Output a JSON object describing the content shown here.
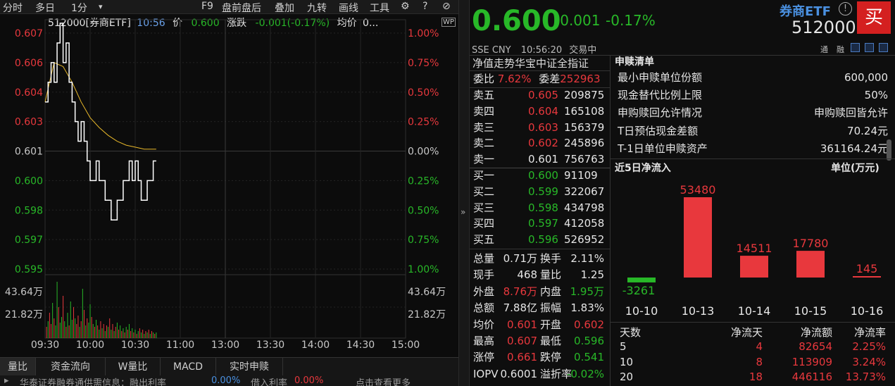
{
  "toolbar": {
    "items": [
      "分时",
      "多日",
      "1分",
      "F9",
      "盘前盘后",
      "叠加",
      "九转",
      "画线",
      "工具"
    ],
    "dropdown_glyph": "▾",
    "gear": "⚙",
    "help": "?",
    "close": "⊘"
  },
  "chart_header": {
    "code_name": "512000[券商ETF]",
    "time": "10:56",
    "price_label": "价",
    "price": "0.600",
    "change_label": "涨跌",
    "change": "-0.001(-0.17%)",
    "avg_label": "均价",
    "avg": "0...",
    "wp": "WP"
  },
  "price_axis_left": [
    "0.607",
    "0.606",
    "0.604",
    "0.603",
    "0.601",
    "0.600",
    "0.598",
    "0.597",
    "0.595"
  ],
  "price_axis_right": [
    "1.00%",
    "0.75%",
    "0.50%",
    "0.25%",
    "0.00%",
    "0.25%",
    "0.50%",
    "0.75%",
    "1.00%"
  ],
  "volume_axis": [
    "43.64万",
    "21.82万"
  ],
  "time_axis": [
    "09:30",
    "10:00",
    "10:30",
    "11:00",
    "13:00",
    "13:30",
    "14:00",
    "14:30",
    "15:00"
  ],
  "chart_data": {
    "type": "line",
    "x_unit": "minutes since 09:30",
    "price_series": [
      [
        0,
        0.6035
      ],
      [
        2,
        0.6045
      ],
      [
        4,
        0.6055
      ],
      [
        6,
        0.6045
      ],
      [
        8,
        0.6065
      ],
      [
        10,
        0.6075
      ],
      [
        12,
        0.6055
      ],
      [
        14,
        0.6065
      ],
      [
        16,
        0.6045
      ],
      [
        18,
        0.6035
      ],
      [
        20,
        0.6025
      ],
      [
        22,
        0.6015
      ],
      [
        24,
        0.6025
      ],
      [
        26,
        0.6015
      ],
      [
        28,
        0.6005
      ],
      [
        30,
        0.5995
      ],
      [
        32,
        0.5995
      ],
      [
        34,
        0.6005
      ],
      [
        36,
        0.5995
      ],
      [
        38,
        0.5995
      ],
      [
        40,
        0.5985
      ],
      [
        42,
        0.5985
      ],
      [
        44,
        0.5975
      ],
      [
        46,
        0.5975
      ],
      [
        48,
        0.5985
      ],
      [
        50,
        0.5985
      ],
      [
        52,
        0.5995
      ],
      [
        54,
        0.5995
      ],
      [
        56,
        0.6005
      ],
      [
        58,
        0.5995
      ],
      [
        60,
        0.6005
      ],
      [
        62,
        0.5995
      ],
      [
        64,
        0.5985
      ],
      [
        66,
        0.5985
      ],
      [
        68,
        0.5995
      ],
      [
        70,
        0.5995
      ],
      [
        72,
        0.6005
      ],
      [
        74,
        0.6005
      ]
    ],
    "avg_series": [
      [
        0,
        0.6035
      ],
      [
        6,
        0.6055
      ],
      [
        12,
        0.6053
      ],
      [
        18,
        0.6045
      ],
      [
        24,
        0.6035
      ],
      [
        30,
        0.6027
      ],
      [
        36,
        0.6022
      ],
      [
        42,
        0.6018
      ],
      [
        48,
        0.6015
      ],
      [
        54,
        0.6013
      ],
      [
        60,
        0.6012
      ],
      [
        66,
        0.6011
      ],
      [
        72,
        0.6011
      ],
      [
        74,
        0.6011
      ]
    ],
    "volume_series": [
      8,
      12,
      18,
      10,
      25,
      14,
      9,
      40,
      22,
      11,
      15,
      30,
      12,
      8,
      18,
      9,
      26,
      13,
      22,
      14,
      10,
      16,
      8,
      12,
      35,
      20,
      9,
      14,
      11,
      24,
      15,
      10,
      8,
      13,
      9,
      6,
      12,
      7,
      10,
      5,
      9,
      8,
      14,
      6,
      10,
      5,
      8,
      11,
      6,
      9,
      5,
      7,
      4,
      8,
      6,
      10,
      5,
      7,
      4,
      6,
      3,
      5,
      7,
      4,
      6,
      3,
      5,
      4,
      6,
      3,
      5,
      4,
      3,
      4
    ],
    "volume_colors": [
      "r",
      "g",
      "r",
      "r",
      "g",
      "r",
      "g",
      "g",
      "r",
      "g",
      "g",
      "r",
      "g",
      "r",
      "g",
      "r",
      "g",
      "g",
      "r",
      "g",
      "r",
      "r",
      "g",
      "r",
      "g",
      "r",
      "g",
      "r",
      "g",
      "g",
      "r",
      "g",
      "r",
      "g",
      "r",
      "g",
      "r",
      "g",
      "r",
      "g",
      "r",
      "g",
      "r",
      "g",
      "r",
      "g",
      "r",
      "g",
      "r",
      "g",
      "r",
      "g",
      "r",
      "g",
      "r",
      "g",
      "r",
      "g",
      "r",
      "g",
      "r",
      "g",
      "r",
      "g",
      "r",
      "g",
      "r",
      "g",
      "r",
      "g",
      "r",
      "g",
      "r",
      "g"
    ]
  },
  "bottom_tabs": [
    "量比",
    "资金流向",
    "W量比",
    "MACD",
    "实时申赎"
  ],
  "ticker": {
    "text": "华泰证券融券通供需信息：融出利率",
    "v1": "0.00%",
    "mid": "借入利率",
    "v2": "0.00%",
    "tail": "点击查看更多"
  },
  "quote": {
    "price": "0.600",
    "change": "-0.001",
    "pct": "-0.17%",
    "name": "券商ETF",
    "code": "512000",
    "buy": "买",
    "market": "SSE CNY",
    "time": "10:56:20",
    "status": "交易中",
    "tong": "通",
    "rong": "融"
  },
  "netval_tab": "净值走势华宝中证全指证",
  "wei": {
    "wb_label": "委比",
    "wb": "7.62%",
    "wc_label": "委差",
    "wc": "252963"
  },
  "sell": [
    {
      "label": "卖五",
      "price": "0.605",
      "vol": "209875"
    },
    {
      "label": "卖四",
      "price": "0.604",
      "vol": "165108"
    },
    {
      "label": "卖三",
      "price": "0.603",
      "vol": "156379"
    },
    {
      "label": "卖二",
      "price": "0.602",
      "vol": "245896"
    },
    {
      "label": "卖一",
      "price": "0.601",
      "vol": "756763"
    }
  ],
  "buy": [
    {
      "label": "买一",
      "price": "0.600",
      "vol": "91109"
    },
    {
      "label": "买二",
      "price": "0.599",
      "vol": "322067"
    },
    {
      "label": "买三",
      "price": "0.598",
      "vol": "434798"
    },
    {
      "label": "买四",
      "price": "0.597",
      "vol": "412058"
    },
    {
      "label": "买五",
      "price": "0.596",
      "vol": "526952"
    }
  ],
  "stats": [
    {
      "l": "总量",
      "v": "0.71万",
      "l2": "换手",
      "v2": "2.11%",
      "c1": "white",
      "c2": "white"
    },
    {
      "l": "现手",
      "v": "468",
      "l2": "量比",
      "v2": "1.25",
      "c1": "white",
      "c2": "white"
    },
    {
      "l": "外盘",
      "v": "8.76万",
      "l2": "内盘",
      "v2": "1.95万",
      "c1": "red",
      "c2": "green"
    },
    {
      "l": "总额",
      "v": "7.88亿",
      "l2": "振幅",
      "v2": "1.83%",
      "c1": "white",
      "c2": "white"
    },
    {
      "l": "均价",
      "v": "0.601",
      "l2": "开盘",
      "v2": "0.602",
      "c1": "red",
      "c2": "red"
    },
    {
      "l": "最高",
      "v": "0.607",
      "l2": "最低",
      "v2": "0.596",
      "c1": "red",
      "c2": "green"
    },
    {
      "l": "涨停",
      "v": "0.661",
      "l2": "跌停",
      "v2": "0.541",
      "c1": "red",
      "c2": "green"
    },
    {
      "l": "IOPV",
      "v": "0.6001",
      "l2": "溢折率",
      "v2": "-0.02%",
      "c1": "white",
      "c2": "green"
    }
  ],
  "redemption": {
    "title": "申赎清单",
    "rows": [
      {
        "l": "最小申赎单位份额",
        "v": "600,000"
      },
      {
        "l": "现金替代比例上限",
        "v": "50%"
      },
      {
        "l": "申购赎回允许情况",
        "v": "申购赎回皆允许"
      },
      {
        "l": "T日预估现金差额",
        "v": "70.24元"
      },
      {
        "l": "T-1日单位申赎资产",
        "v": "361164.24元"
      }
    ]
  },
  "inflow": {
    "title": "近5日净流入",
    "unit": "单位(万元)"
  },
  "inflow_chart": {
    "type": "bar",
    "categories": [
      "10-10",
      "10-13",
      "10-14",
      "10-15",
      "10-16"
    ],
    "values": [
      -3261,
      53480,
      14511,
      17780,
      145
    ],
    "labels": [
      "-3261",
      "53480",
      "14511",
      "17780",
      "145"
    ]
  },
  "days_table": {
    "headers": [
      "天数",
      "净流天",
      "净流额",
      "净流率"
    ],
    "rows": [
      [
        "5",
        "4",
        "82654",
        "2.25%"
      ],
      [
        "10",
        "8",
        "113909",
        "3.24%"
      ],
      [
        "20",
        "18",
        "446116",
        "13.73%"
      ]
    ]
  },
  "colors": {
    "up": "#e8383d",
    "down": "#28b828",
    "price_line": "#ffffff",
    "avg_line": "#e8b82a",
    "accent_blue": "#4a7ac0"
  }
}
